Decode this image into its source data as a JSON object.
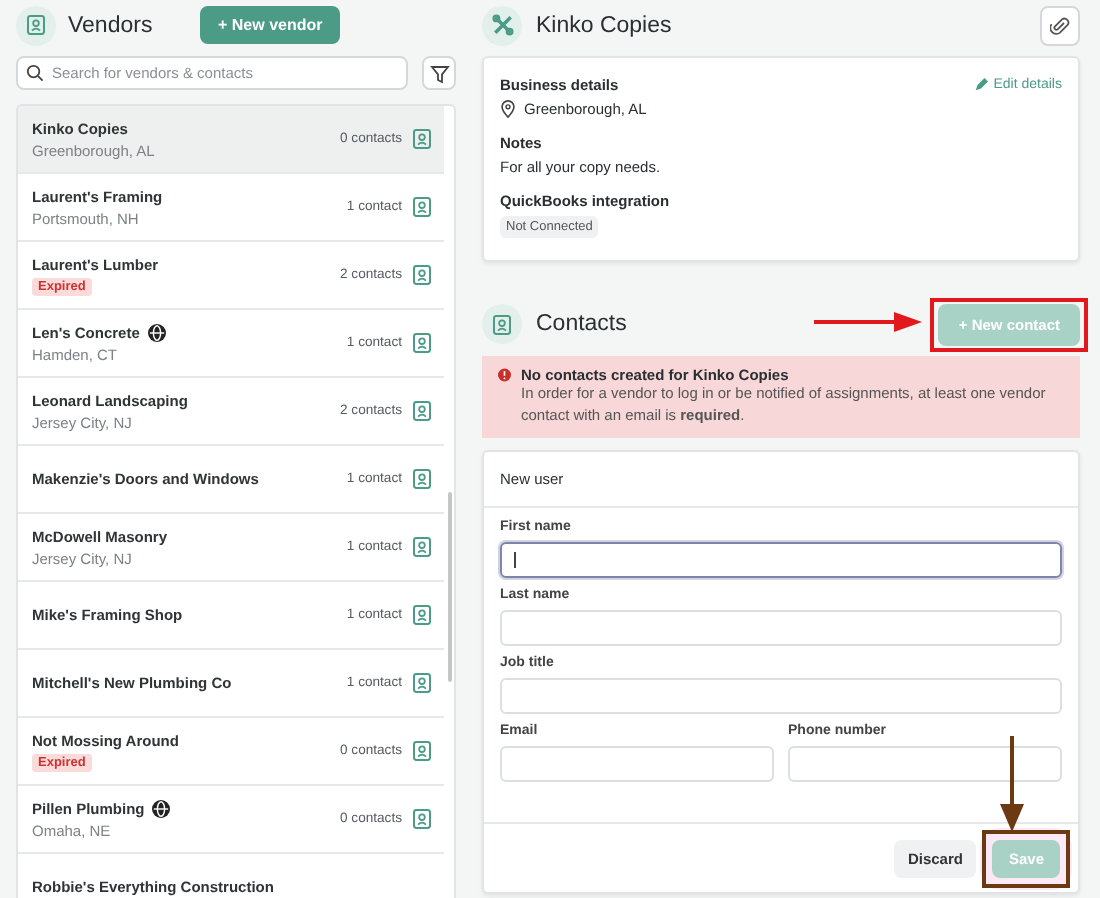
{
  "sidebar": {
    "title": "Vendors",
    "new_button": "+ New vendor",
    "search": {
      "placeholder": "Search for vendors & contacts"
    },
    "vendors": [
      {
        "name": "Kinko Copies",
        "location": "Greenborough, AL",
        "contacts": "0 contacts",
        "selected": true,
        "expired": false,
        "global": false
      },
      {
        "name": "Laurent's Framing",
        "location": "Portsmouth, NH",
        "contacts": "1 contact",
        "selected": false,
        "expired": false,
        "global": false
      },
      {
        "name": "Laurent's Lumber",
        "badge": "Expired",
        "contacts": "2 contacts",
        "selected": false,
        "expired": true,
        "global": false
      },
      {
        "name": "Len's Concrete",
        "location": "Hamden, CT",
        "contacts": "1 contact",
        "selected": false,
        "expired": false,
        "global": true
      },
      {
        "name": "Leonard Landscaping",
        "location": "Jersey City, NJ",
        "contacts": "2 contacts",
        "selected": false,
        "expired": false,
        "global": false
      },
      {
        "name": "Makenzie's Doors and Windows",
        "contacts": "1 contact",
        "selected": false,
        "expired": false,
        "global": false
      },
      {
        "name": "McDowell Masonry",
        "location": "Jersey City, NJ",
        "contacts": "1 contact",
        "selected": false,
        "expired": false,
        "global": false
      },
      {
        "name": "Mike's Framing Shop",
        "contacts": "1 contact",
        "selected": false,
        "expired": false,
        "global": false
      },
      {
        "name": "Mitchell's New Plumbing Co",
        "contacts": "1 contact",
        "selected": false,
        "expired": false,
        "global": false
      },
      {
        "name": "Not Mossing Around",
        "badge": "Expired",
        "contacts": "0 contacts",
        "selected": false,
        "expired": true,
        "global": false
      },
      {
        "name": "Pillen Plumbing",
        "location": "Omaha, NE",
        "contacts": "0 contacts",
        "selected": false,
        "expired": false,
        "global": true
      },
      {
        "name": "Robbie's Everything Construction",
        "selected": false,
        "expired": false,
        "global": false
      }
    ]
  },
  "detail": {
    "title": "Kinko Copies",
    "business": {
      "heading": "Business details",
      "edit_link": "Edit details",
      "location": "Greenborough, AL",
      "notes_heading": "Notes",
      "notes": "For all your copy needs.",
      "integration_heading": "QuickBooks integration",
      "integration_status": "Not Connected"
    },
    "contacts": {
      "heading": "Contacts",
      "new_button": "+ New contact",
      "new_button_disabled": true,
      "alert": {
        "title": "No contacts created for Kinko Copies",
        "body": "In order for a vendor to log in or be notified of assignments, at least one vendor contact with an email is **required**."
      }
    },
    "form": {
      "title": "New user",
      "fields": [
        {
          "label": "First name",
          "focused": true,
          "half": false
        },
        {
          "label": "Last name",
          "focused": false,
          "half": false
        },
        {
          "label": "Job title",
          "focused": false,
          "half": false
        },
        {
          "label": "Email",
          "focused": false,
          "half": true
        },
        {
          "label": "Phone number",
          "focused": false,
          "half": true
        }
      ],
      "discard": "Discard",
      "save": "Save",
      "save_disabled": true
    }
  }
}
